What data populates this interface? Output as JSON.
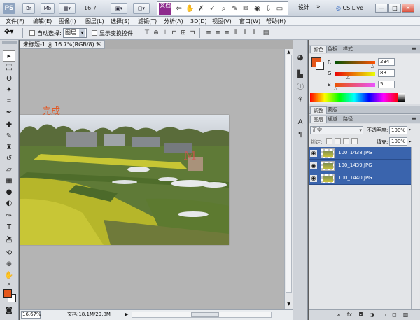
{
  "app": {
    "logo": "PS"
  },
  "appbar": {
    "zoom_value": "16.7",
    "vr_red_label": "文档",
    "design_label": "设计",
    "cslive_label": "CS Live",
    "window_buttons": [
      "—",
      "□",
      "✕"
    ]
  },
  "menubar": {
    "items": [
      "文件(F)",
      "编辑(E)",
      "图像(I)",
      "图层(L)",
      "选择(S)",
      "滤镜(T)",
      "分析(A)",
      "3D(D)",
      "视图(V)",
      "窗口(W)",
      "帮助(H)"
    ]
  },
  "options": {
    "auto_select_label": "自动选择:",
    "layer_select_value": "图层",
    "transform_label": "显示变换控件"
  },
  "document": {
    "tab_title": "未标题-1 @ 16.7%(RGB/8) *",
    "tab_close": "×",
    "overlay_text": "完成",
    "zoom_status": "16.67%",
    "doc_info": "文档:18.1M/29.8M"
  },
  "color_panel": {
    "tabs": [
      "颜色",
      "色板",
      "样式"
    ],
    "r_label": "R",
    "g_label": "G",
    "b_label": "B",
    "r_value": "234",
    "g_value": "83",
    "b_value": "5",
    "fg_color": "#e4571b"
  },
  "adjust_tabs": [
    "调整",
    "蒙版"
  ],
  "layers_panel": {
    "tabs": [
      "图层",
      "通道",
      "路径"
    ],
    "blend_mode": "正常",
    "opacity_label": "不透明度:",
    "opacity_value": "100%",
    "lock_label": "锁定:",
    "fill_label": "填充:",
    "fill_value": "100%",
    "layers": [
      {
        "name": "100_1438.JPG"
      },
      {
        "name": "100_1439.JPG"
      },
      {
        "name": "100_1440.JPG"
      }
    ]
  },
  "colors": {
    "accent_orange": "#e4571b",
    "selection_blue": "#3a64ad"
  }
}
